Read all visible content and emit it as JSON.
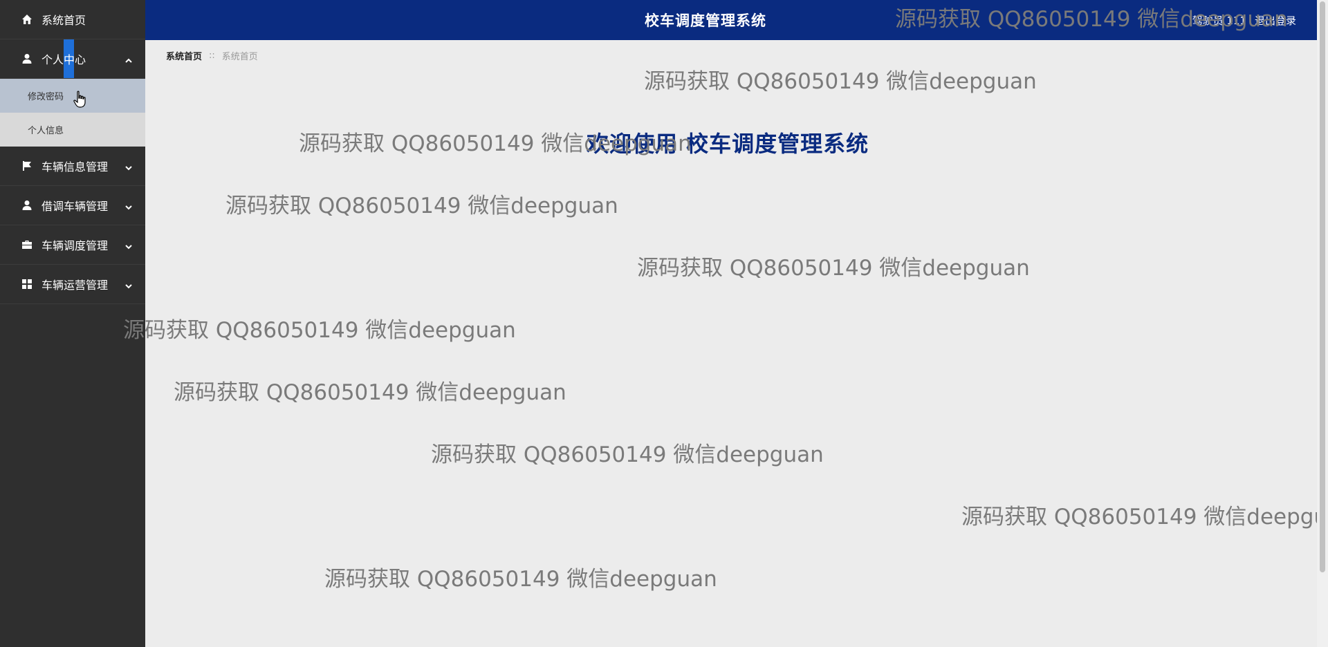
{
  "header": {
    "title": "校车调度管理系统",
    "user_label": "驾驶员 111",
    "logout_label": "退出登录"
  },
  "sidebar": {
    "items": [
      {
        "label": "系统首页",
        "icon": "home-icon"
      },
      {
        "label": "个人中心",
        "icon": "user-icon",
        "expanded": true,
        "children": [
          {
            "label": "修改密码"
          },
          {
            "label": "个人信息"
          }
        ]
      },
      {
        "label": "车辆信息管理",
        "icon": "flag-icon"
      },
      {
        "label": "借调车辆管理",
        "icon": "user-icon"
      },
      {
        "label": "车辆调度管理",
        "icon": "briefcase-icon"
      },
      {
        "label": "车辆运营管理",
        "icon": "grid-icon"
      }
    ]
  },
  "breadcrumb": {
    "items": [
      "系统首页",
      "系统首页"
    ],
    "separator": "::"
  },
  "welcome": "欢迎使用 校车调度管理系统",
  "watermark": "源码获取 QQ86050149 微信deepguan",
  "colors": {
    "header": "#0a2b80",
    "sidebar": "#2f2f2f",
    "accent": "#1e6fd9"
  }
}
